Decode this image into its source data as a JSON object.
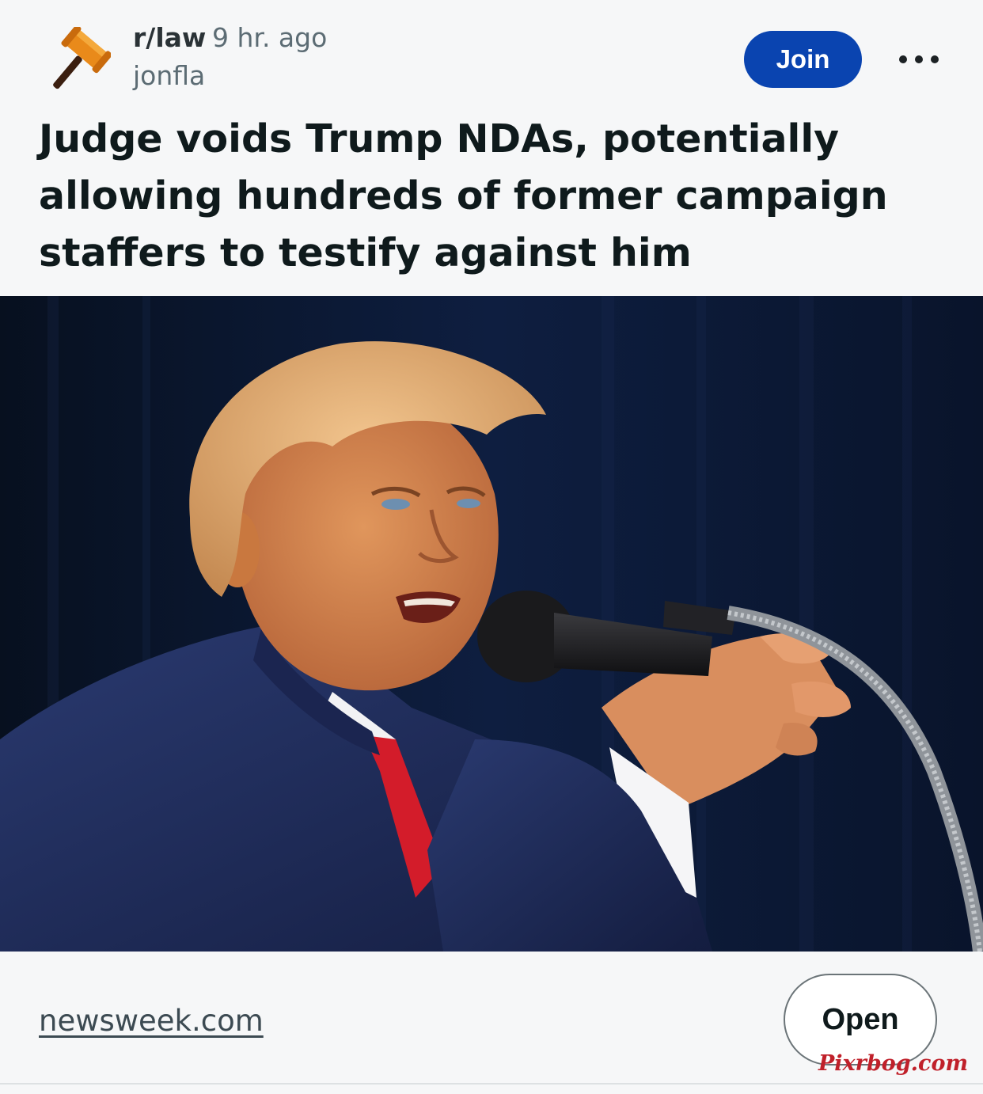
{
  "post": {
    "subreddit": "r/law",
    "age": "9 hr. ago",
    "author": "jonfla",
    "join_label": "Join",
    "more_icon": "ellipsis-icon",
    "subreddit_icon": "gavel-icon",
    "title": "Judge voids Trump NDAs, potentially allowing hundreds of former campaign staffers to testify against him",
    "image_alt": "Man in a navy suit and red tie speaking into a microphone and pointing forward against a dark blue curtain"
  },
  "link": {
    "domain": "newsweek.com",
    "open_label": "Open",
    "watermark": "Pixrbog.com"
  },
  "colors": {
    "background": "#f6f7f8",
    "join_button": "#0a44b0",
    "text_primary": "#0f1a1c",
    "text_secondary": "#5c6c74",
    "watermark": "#c0202a"
  }
}
